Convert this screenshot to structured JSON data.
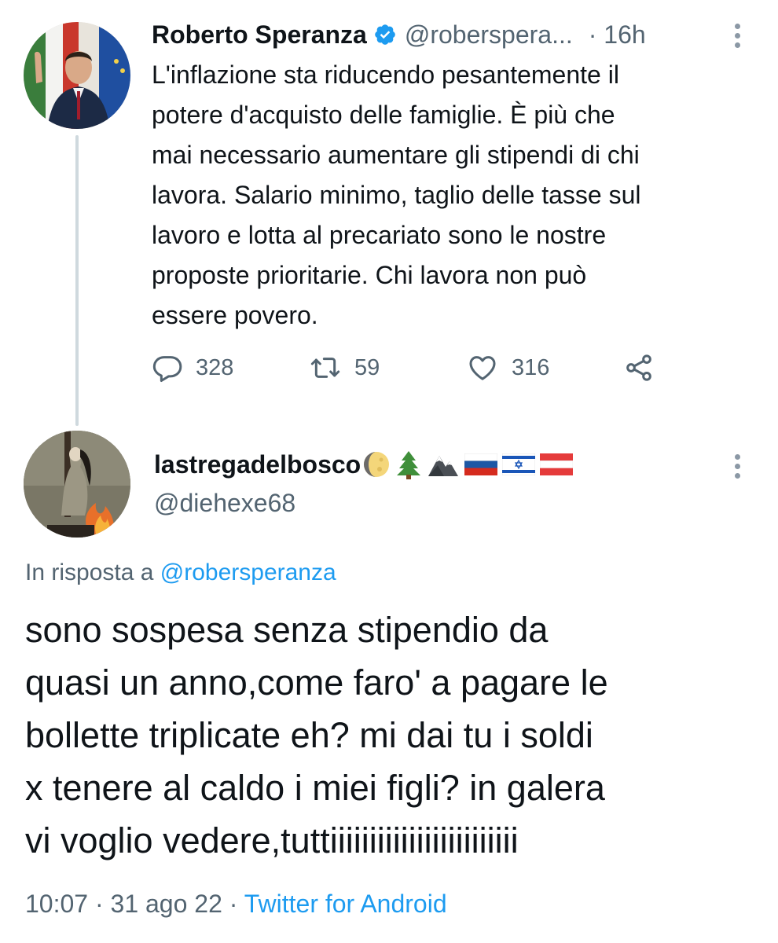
{
  "parent_tweet": {
    "author_name": "Roberto Speranza",
    "handle": "@roberspera...",
    "time": "· 16h",
    "text": "L'inflazione sta riducendo pesantemente il\npotere d'acquisto delle famiglie. È più che\nmai necessario aumentare gli stipendi di chi\nlavora. Salario minimo, taglio delle tasse sul\nlavoro e lotta al precariato sono le nostre\nproposte prioritarie. Chi lavora non può\nessere povero.",
    "actions": {
      "reply_count": "328",
      "retweet_count": "59",
      "like_count": "316"
    },
    "icons": {
      "verified": "verified-badge-icon",
      "reply": "comment-icon",
      "retweet": "retweet-icon",
      "like": "heart-icon",
      "share": "share-icon",
      "more": "more-vertical-icon"
    }
  },
  "reply_tweet": {
    "author_name": "lastregadelbosco",
    "name_emojis": [
      "moon-icon",
      "evergreen-tree-icon",
      "mountain-icon",
      "flag-russia-icon",
      "flag-israel-icon",
      "flag-austria-icon"
    ],
    "handle": "@diehexe68",
    "in_reply_prefix": "In risposta a ",
    "in_reply_mention": "@robersperanza",
    "text": "sono sospesa senza stipendio da\nquasi un anno,come faro' a pagare le\nbollette triplicate eh? mi dai tu i soldi\nx tenere al caldo i miei figli? in galera\nvi voglio vedere,tuttiiiiiiiiiiiiiiiiiiiiiiii",
    "timestamp": "10:07 · 31 ago 22 · ",
    "source": "Twitter for Android"
  },
  "colors": {
    "text_primary": "#0f1419",
    "text_secondary": "#536471",
    "link": "#1d9bf0",
    "thread_line": "#cfd9de"
  }
}
